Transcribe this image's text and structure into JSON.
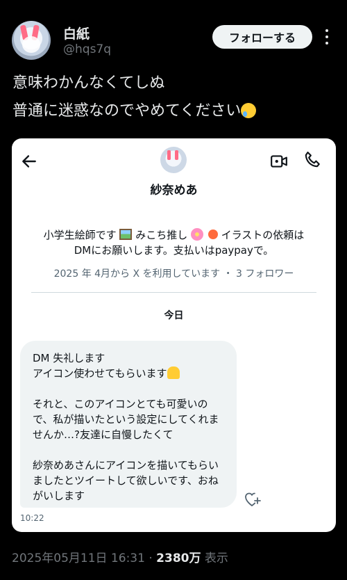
{
  "author": {
    "display_name": "白紙",
    "handle": "@hqs7q",
    "follow_label": "フォローする"
  },
  "tweet": {
    "line1": "意味わかんなくてしぬ",
    "line2": "普通に迷惑なのでやめてください"
  },
  "dm_screenshot": {
    "profile_name": "紗奈めあ",
    "bio_part1": "小学生絵師です",
    "bio_part2": " みこち推し",
    "bio_part3": " イラストの依頼は",
    "bio_line2": "DMにお願いします。支払いはpaypayで。",
    "joined_info": "2025 年 4月から X を利用しています ・ 3 フォロワー",
    "date_divider": "今日",
    "message_line1": "DM 失礼します",
    "message_line2": "アイコン使わせてもらいます",
    "message_para2": "それと、このアイコンとても可愛いので、私が描いたという設定にしてくれませんか…?友達に自慢したくて",
    "message_para3": "紗奈めあさんにアイコンを描いてもらいましたとツイートして欲しいです、おねがいします",
    "message_time": "10:22"
  },
  "meta": {
    "timestamp": "2025年05月11日 16:31",
    "separator": " · ",
    "views_count": "2380万",
    "views_label": " 表示"
  },
  "icons": [
    "more-icon",
    "back-arrow-icon",
    "video-call-icon",
    "phone-icon",
    "add-reaction-icon"
  ]
}
